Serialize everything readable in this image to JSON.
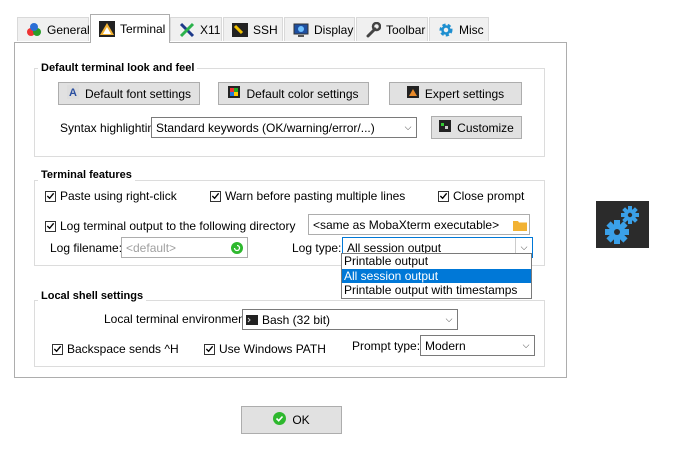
{
  "tabs": [
    {
      "label": "General",
      "icon": "general-icon"
    },
    {
      "label": "Terminal",
      "icon": "terminal-icon",
      "active": true
    },
    {
      "label": "X11",
      "icon": "x11-icon"
    },
    {
      "label": "SSH",
      "icon": "ssh-icon"
    },
    {
      "label": "Display",
      "icon": "display-icon"
    },
    {
      "label": "Toolbar",
      "icon": "wrench-icon"
    },
    {
      "label": "Misc",
      "icon": "gear-icon"
    }
  ],
  "look": {
    "title": "Default terminal look and feel",
    "font_button": "Default font settings",
    "color_button": "Default color settings",
    "expert_button": "Expert settings",
    "syntax_label": "Syntax highlighting:",
    "syntax_value": "Standard keywords (OK/warning/error/...)",
    "customize_button": "Customize"
  },
  "features": {
    "title": "Terminal features",
    "paste_rightclick": {
      "label": "Paste using right-click",
      "checked": true
    },
    "warn_paste": {
      "label": "Warn before pasting multiple lines",
      "checked": true
    },
    "close_prompt": {
      "label": "Close prompt",
      "checked": true
    },
    "log_output": {
      "label": "Log terminal output to the following directory",
      "checked": true
    },
    "log_dir_value": "<same as MobaXterm executable>",
    "log_filename_label": "Log filename:",
    "log_filename_placeholder": "<default>",
    "log_type_label": "Log type:",
    "log_type_value": "All session output",
    "log_type_options": [
      "Printable output",
      "All session output",
      "Printable output with timestamps"
    ],
    "log_type_selected_index": 1
  },
  "shell": {
    "title": "Local shell settings",
    "env_label": "Local terminal environment:",
    "env_value": "Bash (32 bit)",
    "backspace": {
      "label": "Backspace sends ^H",
      "checked": true
    },
    "windows_path": {
      "label": "Use Windows PATH",
      "checked": true
    },
    "prompt_label": "Prompt type:",
    "prompt_value": "Modern"
  },
  "ok_button": "OK",
  "colors": {
    "accent": "#0078d7",
    "gear_bg": "#2b2b2b",
    "gear_blue": "#3aa0e8",
    "ok_green": "#2eb82e"
  }
}
